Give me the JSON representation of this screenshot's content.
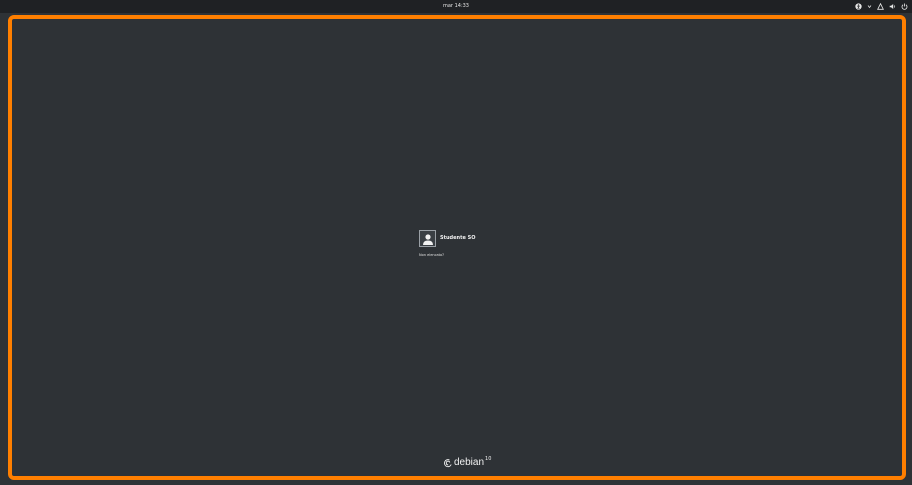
{
  "topbar": {
    "clock": "mar 14:33",
    "tray_icons": [
      "accessibility-icon",
      "chevron-down-icon",
      "network-icon",
      "volume-icon",
      "power-icon"
    ]
  },
  "login": {
    "username": "Studente SO",
    "not_listed_label": "Non elencato?"
  },
  "branding": {
    "logo_word": "debian",
    "logo_version": "10"
  },
  "colors": {
    "background": "#2e3236",
    "topbar": "#1f2124",
    "frame_highlight": "#ff7f00"
  }
}
